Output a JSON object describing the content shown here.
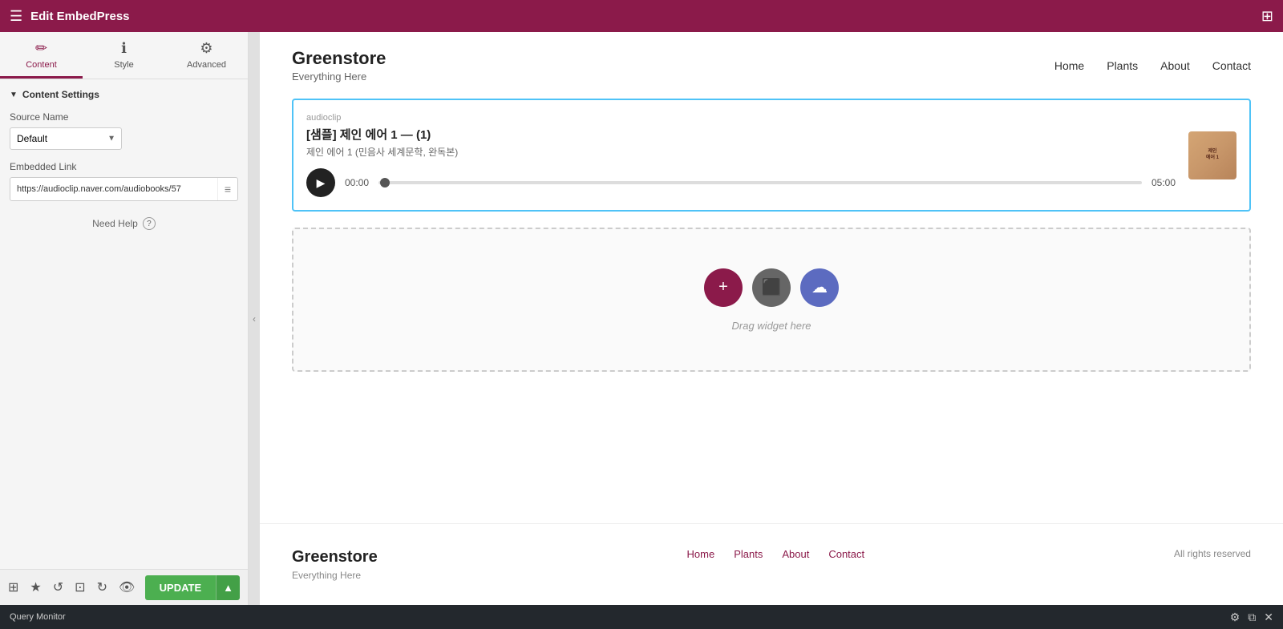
{
  "topbar": {
    "title": "Edit EmbedPress",
    "hamburger_icon": "☰",
    "grid_icon": "⊞"
  },
  "sidebar": {
    "tabs": [
      {
        "id": "content",
        "label": "Content",
        "icon": "✏️",
        "active": true
      },
      {
        "id": "style",
        "label": "Style",
        "icon": "ℹ️",
        "active": false
      },
      {
        "id": "advanced",
        "label": "Advanced",
        "icon": "⚙️",
        "active": false
      }
    ],
    "section_title": "Content Settings",
    "source_name_label": "Source Name",
    "source_name_default": "Default",
    "embedded_link_label": "Embedded Link",
    "embedded_link_value": "https://audioclip.naver.com/audiobooks/57",
    "need_help_label": "Need Help"
  },
  "bottom_toolbar": {
    "update_label": "UPDATE",
    "icons": [
      "layers",
      "star",
      "undo",
      "grid",
      "refresh",
      "eye"
    ]
  },
  "site_header": {
    "logo": "Greenstore",
    "tagline": "Everything Here",
    "nav": [
      {
        "label": "Home",
        "active": false
      },
      {
        "label": "Plants",
        "active": false
      },
      {
        "label": "About",
        "active": false
      },
      {
        "label": "Contact",
        "active": false
      }
    ]
  },
  "audioclip": {
    "source": "audioclip",
    "title": "[샘플] 제인 에어 1 — (1)",
    "subtitle": "제인 에어 1 (민음사 세계문학, 완독본)",
    "time_start": "00:00",
    "time_end": "05:00"
  },
  "drop_zone": {
    "label": "Drag widget here",
    "icons": [
      {
        "type": "add",
        "symbol": "+"
      },
      {
        "type": "widget",
        "symbol": "⬛"
      },
      {
        "type": "embed",
        "symbol": "☁"
      }
    ]
  },
  "site_footer": {
    "logo": "Greenstore",
    "tagline": "Everything Here",
    "nav": [
      {
        "label": "Home"
      },
      {
        "label": "Plants"
      },
      {
        "label": "About"
      },
      {
        "label": "Contact"
      }
    ],
    "rights": "All rights reserved"
  },
  "query_monitor": {
    "label": "Query Monitor"
  }
}
